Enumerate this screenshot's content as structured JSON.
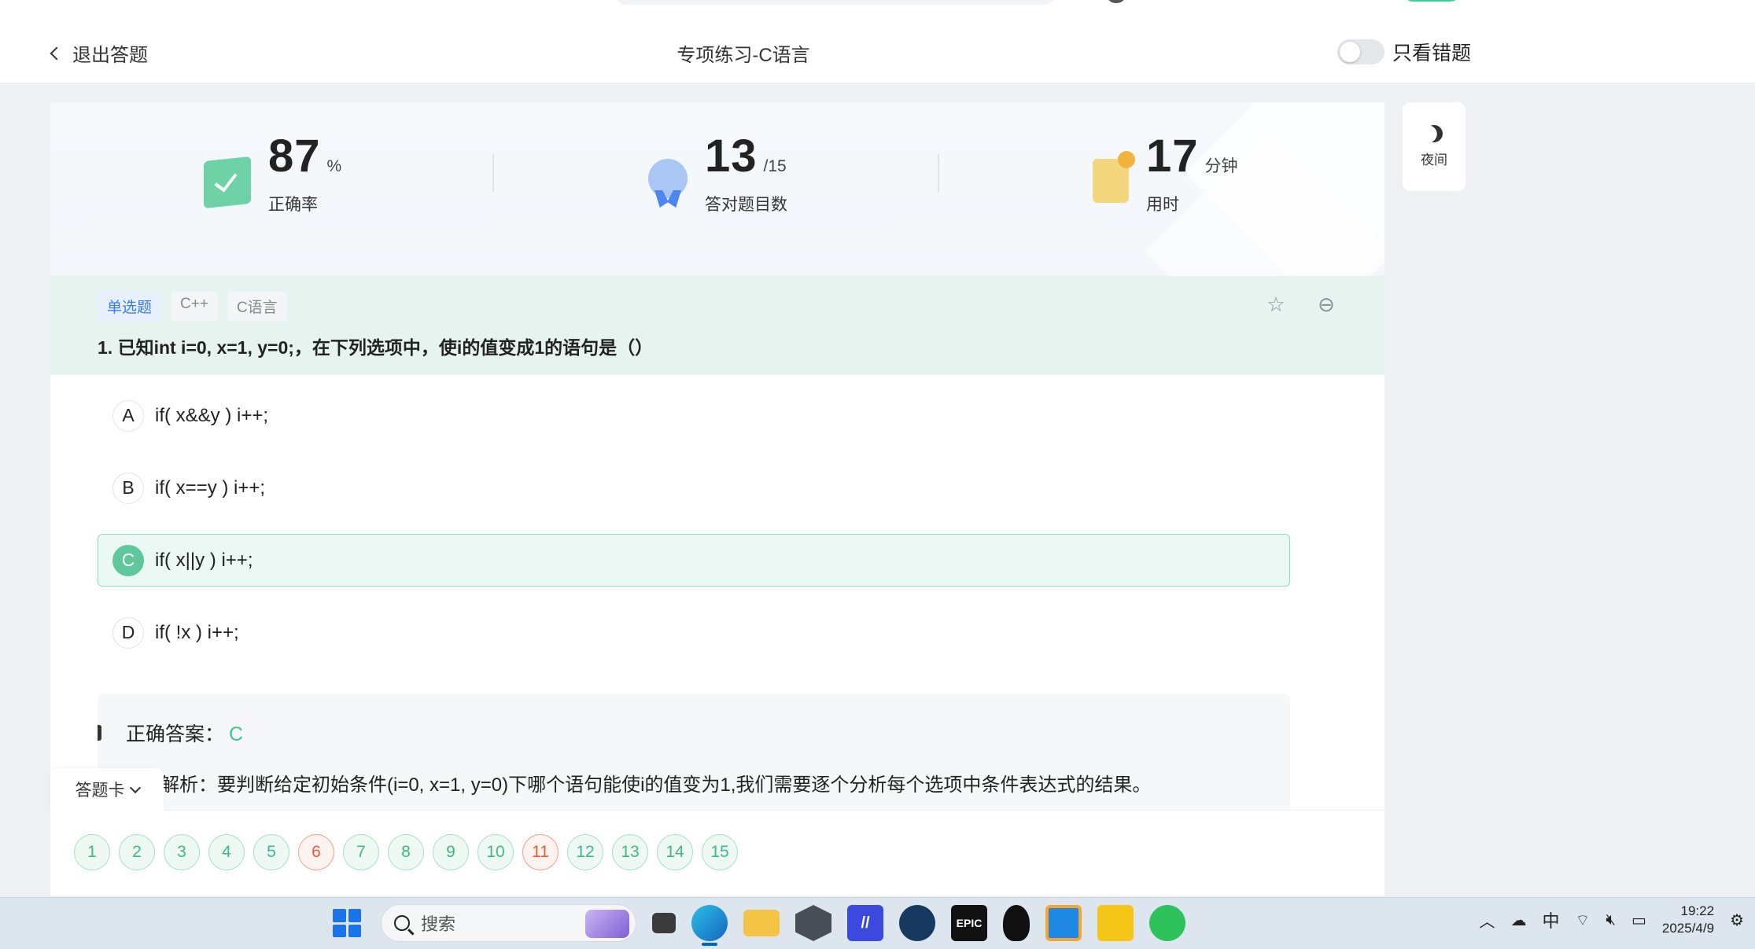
{
  "header": {
    "exit_label": "退出答题",
    "title": "专项练习-C语言",
    "wrong_only_label": "只看错题",
    "wrong_only_on": false
  },
  "stats": [
    {
      "value": "87",
      "unit": "%",
      "label": "正确率"
    },
    {
      "value": "13",
      "unit": "/15",
      "label": "答对题目数"
    },
    {
      "value": "17",
      "unit": "分钟",
      "label": "用时"
    }
  ],
  "night_label": "夜间",
  "question": {
    "tags": [
      "单选题",
      "C++",
      "C语言"
    ],
    "text": "1. 已知int i=0, x=1, y=0;，在下列选项中，使i的值变成1的语句是（）",
    "options": [
      {
        "letter": "A",
        "text": "if( x&&y ) i++;"
      },
      {
        "letter": "B",
        "text": "if( x==y ) i++;"
      },
      {
        "letter": "C",
        "text": "if( x||y ) i++;"
      },
      {
        "letter": "D",
        "text": "if( !x ) i++;"
      }
    ],
    "selected": "C",
    "correct_label": "正确答案：",
    "correct_value": "C",
    "analysis": "解析：要判断给定初始条件(i=0, x=1, y=0)下哪个语句能使i的值变为1,我们需要逐个分析每个选项中条件表达式的结果。"
  },
  "answer_sheet": {
    "label": "答题卡",
    "numbers": [
      "1",
      "2",
      "3",
      "4",
      "5",
      "6",
      "7",
      "8",
      "9",
      "10",
      "11",
      "12",
      "13",
      "14",
      "15"
    ],
    "wrong": [
      "6",
      "11"
    ]
  },
  "taskbar": {
    "search_placeholder": "搜索",
    "ime": "中",
    "time": "19:22",
    "date": "2025/4/9"
  },
  "colors": {
    "accent_green": "#46c28d",
    "wrong_red": "#e65b3c",
    "tag_blue": "#3a7de9"
  }
}
